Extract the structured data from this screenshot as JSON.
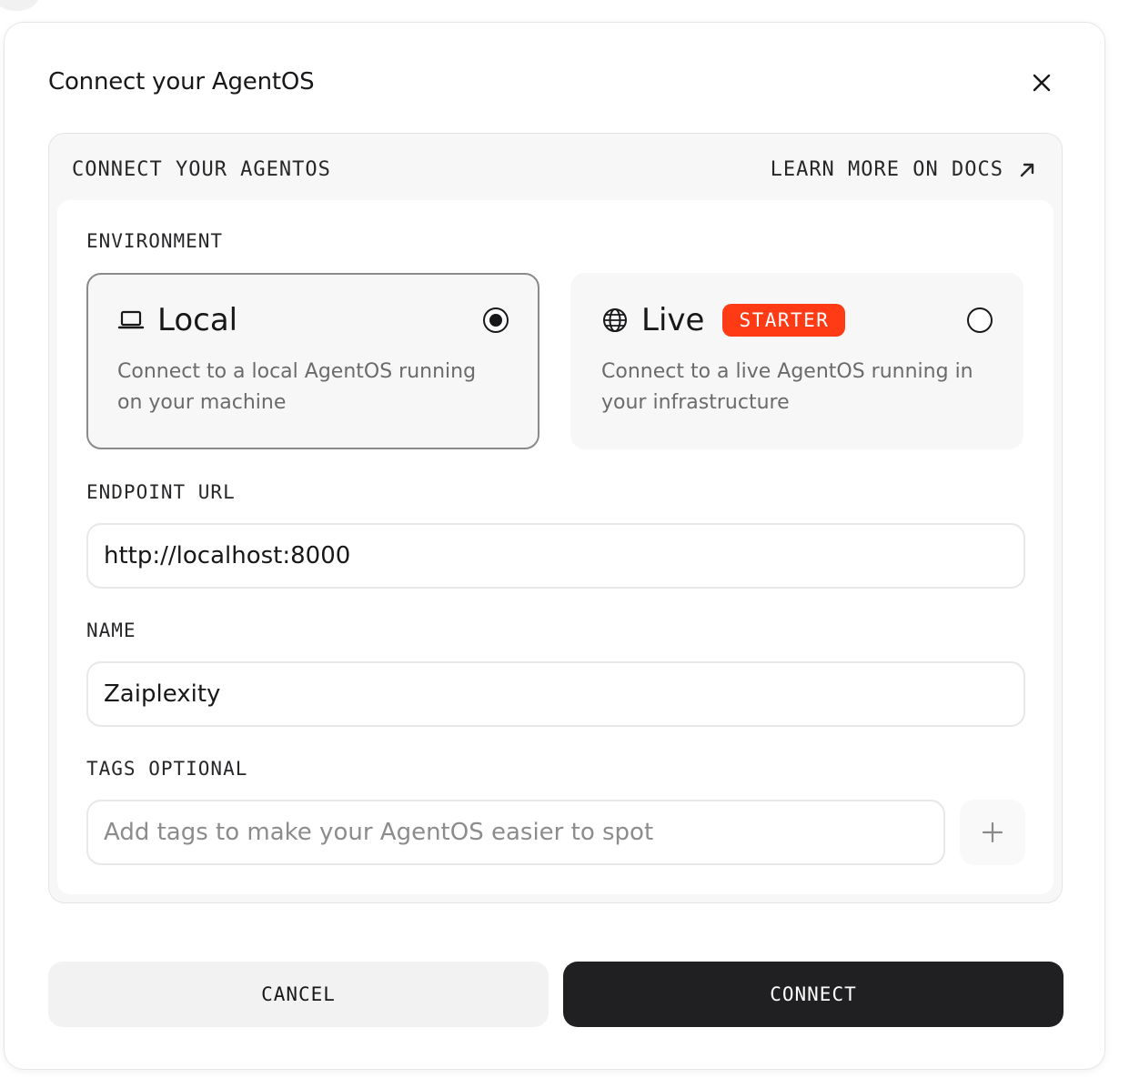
{
  "modal": {
    "title": "Connect your AgentOS",
    "close_icon": "close-icon"
  },
  "panel": {
    "heading": "CONNECT YOUR AGENTOS",
    "docs_link": "LEARN MORE ON DOCS",
    "docs_icon": "arrow-up-right-icon"
  },
  "environment": {
    "label": "ENVIRONMENT",
    "selected": "Local",
    "options": [
      {
        "title": "Local",
        "icon": "laptop-icon",
        "description": "Connect to a local AgentOS running on your machine",
        "checked": true
      },
      {
        "title": "Live",
        "icon": "globe-icon",
        "badge": "STARTER",
        "description": "Connect to a live AgentOS running in your infrastructure",
        "checked": false
      }
    ]
  },
  "endpoint": {
    "label": "ENDPOINT URL",
    "value": "http://localhost:8000"
  },
  "name": {
    "label": "NAME",
    "value": "Zaiplexity"
  },
  "tags": {
    "label": "TAGS OPTIONAL",
    "placeholder": "Add tags to make your AgentOS easier to spot",
    "add_icon": "plus-icon"
  },
  "actions": {
    "cancel_label": "CANCEL",
    "connect_label": "CONNECT"
  },
  "colors": {
    "badge": "#ff3b16",
    "primary_button": "#202022",
    "selected_border": "#8a8a8a"
  }
}
